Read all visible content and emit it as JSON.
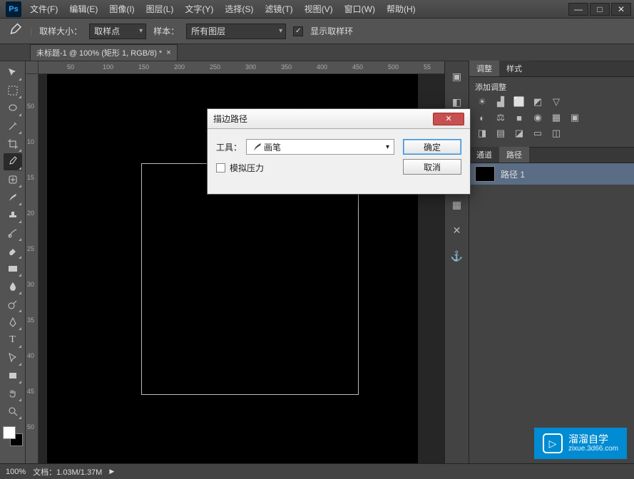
{
  "app": {
    "logo": "Ps"
  },
  "menu": [
    "文件(F)",
    "编辑(E)",
    "图像(I)",
    "图层(L)",
    "文字(Y)",
    "选择(S)",
    "滤镜(T)",
    "视图(V)",
    "窗口(W)",
    "帮助(H)"
  ],
  "winctrl": {
    "min": "—",
    "max": "□",
    "close": "✕"
  },
  "optbar": {
    "sample_size_label": "取样大小：",
    "sample_size_value": "取样点",
    "sample_label": "样本：",
    "sample_value": "所有图层",
    "show_ring": "显示取样环"
  },
  "doctab": {
    "title": "未标题-1 @ 100% (矩形 1, RGB/8) *"
  },
  "ruler_h": [
    "50",
    "100",
    "150",
    "200",
    "250",
    "300",
    "350",
    "400",
    "450",
    "500",
    "55"
  ],
  "ruler_v": [
    "50",
    "10",
    "15",
    "20",
    "25",
    "30",
    "35",
    "40",
    "45",
    "50"
  ],
  "panels": {
    "adjust_tab": "调整",
    "styles_tab": "样式",
    "add_adjust": "添加调整",
    "channels_tab": "通道",
    "paths_tab": "路径",
    "path_item": "路径 1"
  },
  "status": {
    "zoom": "100%",
    "doc": "文档：1.03M/1.37M"
  },
  "dialog": {
    "title": "描边路径",
    "tool_label": "工具：",
    "tool_value": "画笔",
    "simulate": "模拟压力",
    "ok": "确定",
    "cancel": "取消"
  },
  "watermark": {
    "text": "溜溜自学",
    "sub": "zixue.3d66.com"
  }
}
